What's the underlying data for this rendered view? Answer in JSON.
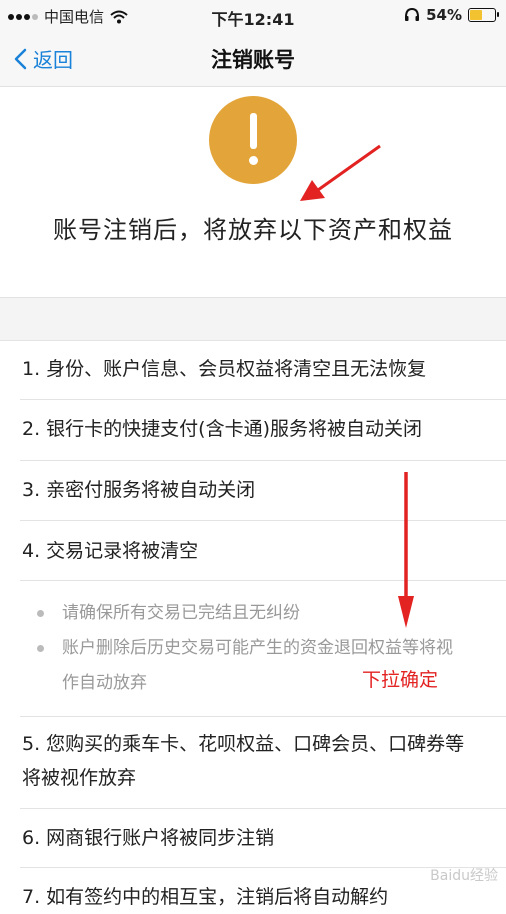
{
  "status": {
    "carrier": "中国电信",
    "time": "下午12:41",
    "battery": "54%",
    "battery_level": 0.54
  },
  "nav": {
    "back_label": "返回",
    "title": "注销账号"
  },
  "header": {
    "headline": "账号注销后，将放弃以下资产和权益"
  },
  "items": [
    "1. 身份、账户信息、会员权益将清空且无法恢复",
    "2. 银行卡的快捷支付(含卡通)服务将被自动关闭",
    "3. 亲密付服务将被自动关闭",
    "4. 交易记录将被清空"
  ],
  "sub_items": [
    "请确保所有交易已完结且无纠纷",
    "账户删除后历史交易可能产生的资金退回权益等将视",
    "作自动放弃"
  ],
  "items_more": [
    "5. 您购买的乘车卡、花呗权益、口碑会员、口碑券等",
    "将被视作放弃",
    "6. 网商银行账户将被同步注销",
    "7. 如有签约中的相互宝，注销后将自动解约"
  ],
  "annotation": "下拉确定",
  "watermark": "Baidu经验",
  "colors": {
    "accent": "#1a82d8",
    "warning": "#e3a53a",
    "annotation": "#e32222"
  }
}
